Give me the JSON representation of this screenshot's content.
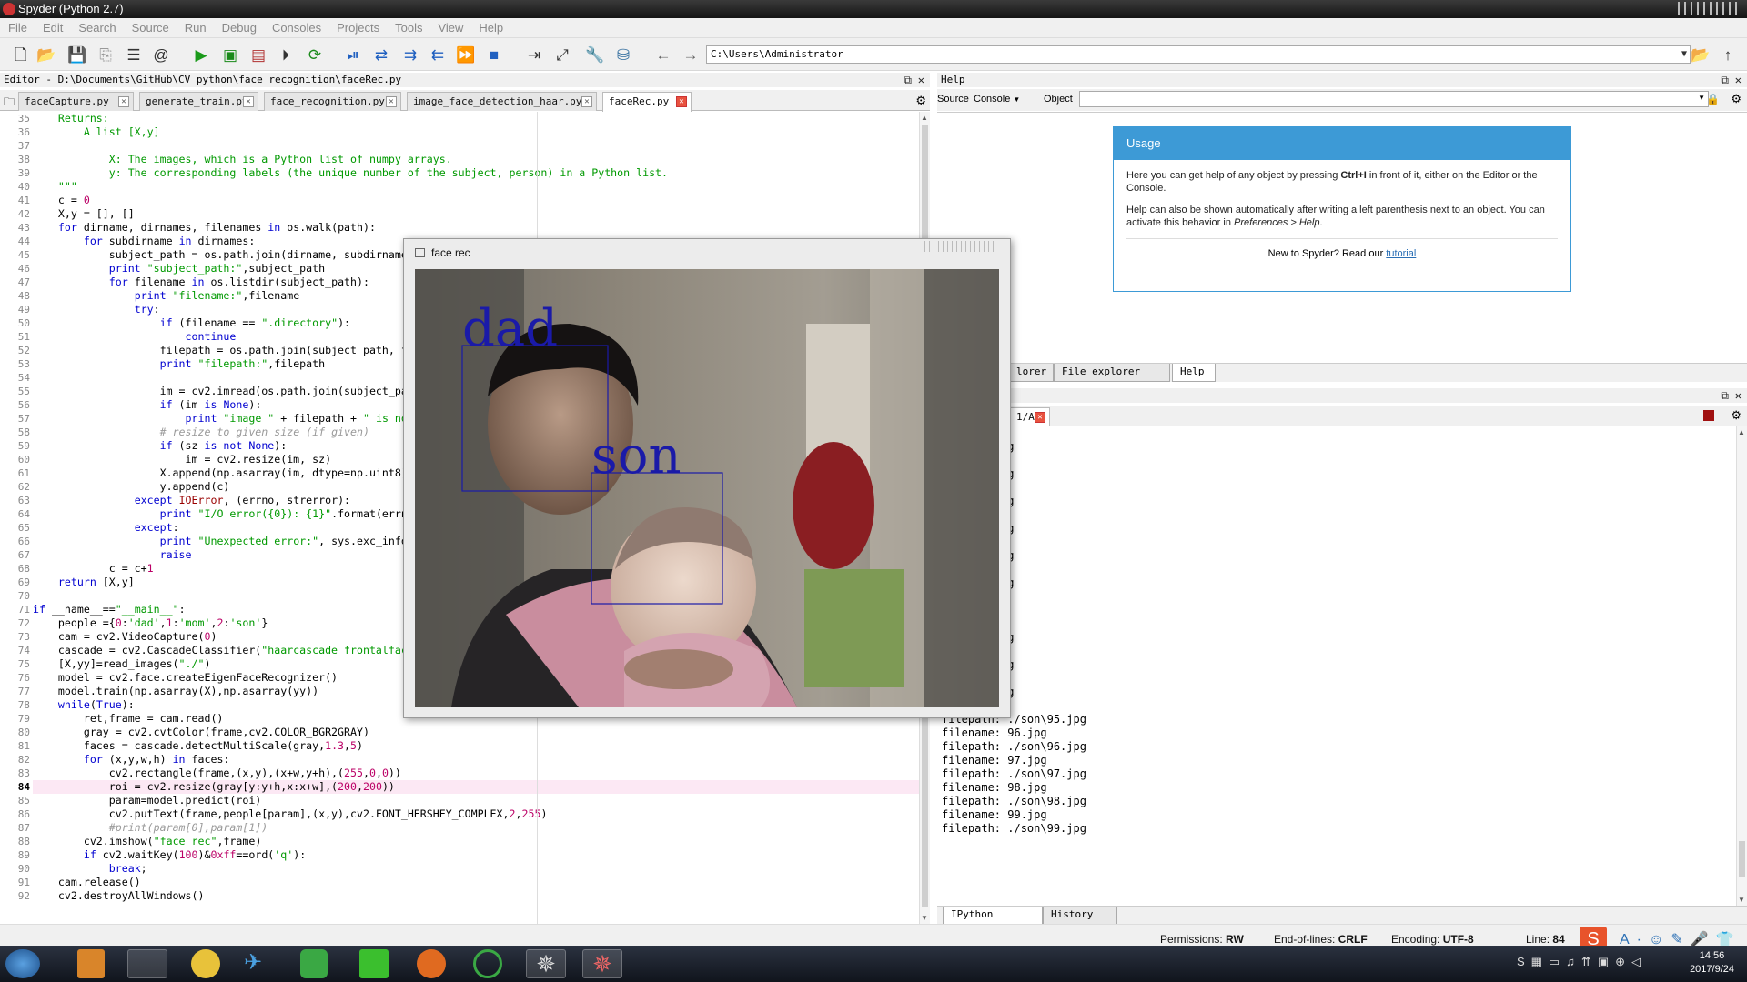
{
  "window": {
    "title": "Spyder (Python 2.7)"
  },
  "menu": [
    "File",
    "Edit",
    "Search",
    "Source",
    "Run",
    "Debug",
    "Consoles",
    "Projects",
    "Tools",
    "View",
    "Help"
  ],
  "toolbar": {
    "path": "C:\\Users\\Administrator"
  },
  "editor": {
    "title": "Editor - D:\\Documents\\GitHub\\CV_python\\face_recognition\\faceRec.py",
    "tabs": [
      "faceCapture.py",
      "generate_train.py",
      "face_recognition.py",
      "image_face_detection_haar.py",
      "faceRec.py"
    ],
    "active_tab": 4,
    "current_line": 84,
    "first_line": 35
  },
  "help": {
    "title": "Help",
    "source_label": "Source",
    "source_value": "Console",
    "object_label": "Object",
    "usage_title": "Usage",
    "usage_p1_a": "Here you can get help of any object by pressing ",
    "usage_p1_key": "Ctrl+I",
    "usage_p1_b": " in front of it, either on the Editor or the Console.",
    "usage_p2_a": "Help can also be shown automatically after writing a left parenthesis next to an object. You can activate this behavior in ",
    "usage_p2_em": "Preferences > Help",
    "usage_p2_b": ".",
    "footer_text": "New to Spyder? Read our ",
    "footer_link": "tutorial",
    "tabs": [
      "lorer",
      "File explorer",
      "Help"
    ]
  },
  "console": {
    "title": "le",
    "tab": "1/A",
    "lines": [
      "4.jpg",
      "/son\\84.jpg",
      "5.jpg",
      "/son\\85.jpg",
      "6.jpg",
      "/son\\86.jpg",
      "7.jpg",
      "/son\\87.jpg",
      "8.jpg",
      "/son\\88.jpg",
      "9.jpg",
      "/son\\89.jpg",
      ".jpg",
      "/son\\9.jpg",
      "0.jpg",
      "/son\\90.jpg",
      "2.jpg",
      "/son\\92.jpg",
      "3.jpg",
      "/son\\93.jpg",
      "5.jpg",
      "filepath: ./son\\95.jpg",
      "filename: 96.jpg",
      "filepath: ./son\\96.jpg",
      "filename: 97.jpg",
      "filepath: ./son\\97.jpg",
      "filename: 98.jpg",
      "filepath: ./son\\98.jpg",
      "filename: 99.jpg",
      "filepath: ./son\\99.jpg"
    ],
    "bottom_tabs": [
      "IPython console",
      "History log"
    ]
  },
  "status": {
    "permissions_label": "Permissions:",
    "permissions": "RW",
    "eol_label": "End-of-lines:",
    "eol": "CRLF",
    "enc_label": "Encoding:",
    "enc": "UTF-8",
    "line_label": "Line:",
    "line": "84"
  },
  "face_window": {
    "title": "face rec",
    "labels": [
      "dad",
      "son"
    ]
  },
  "taskbar": {
    "time": "14:56",
    "date": "2017/9/24"
  },
  "colors": {
    "accent": "#3d9ad6",
    "highlight_line": "#fce8f4",
    "face_box": "#1a1aa8"
  }
}
